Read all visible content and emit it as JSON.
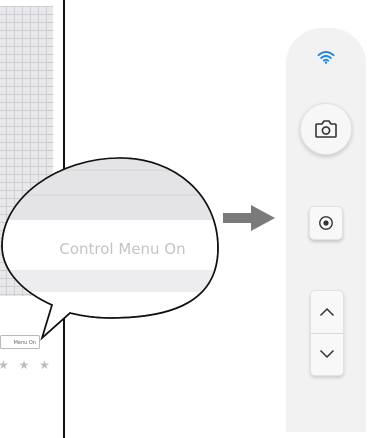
{
  "device_preview": {
    "status_pill": "Menu On",
    "stars": "★ ★ ★"
  },
  "callout": {
    "label": "Control Menu On"
  },
  "control_panel": {
    "wifi_icon": "wifi-icon",
    "capture_icon": "camera-icon",
    "record_icon": "record-icon",
    "up_icon": "chevron-up-icon",
    "down_icon": "chevron-down-icon",
    "colors": {
      "wifi": "#1e88e5",
      "panel": "#f2f2f2",
      "icon": "#333333"
    }
  }
}
